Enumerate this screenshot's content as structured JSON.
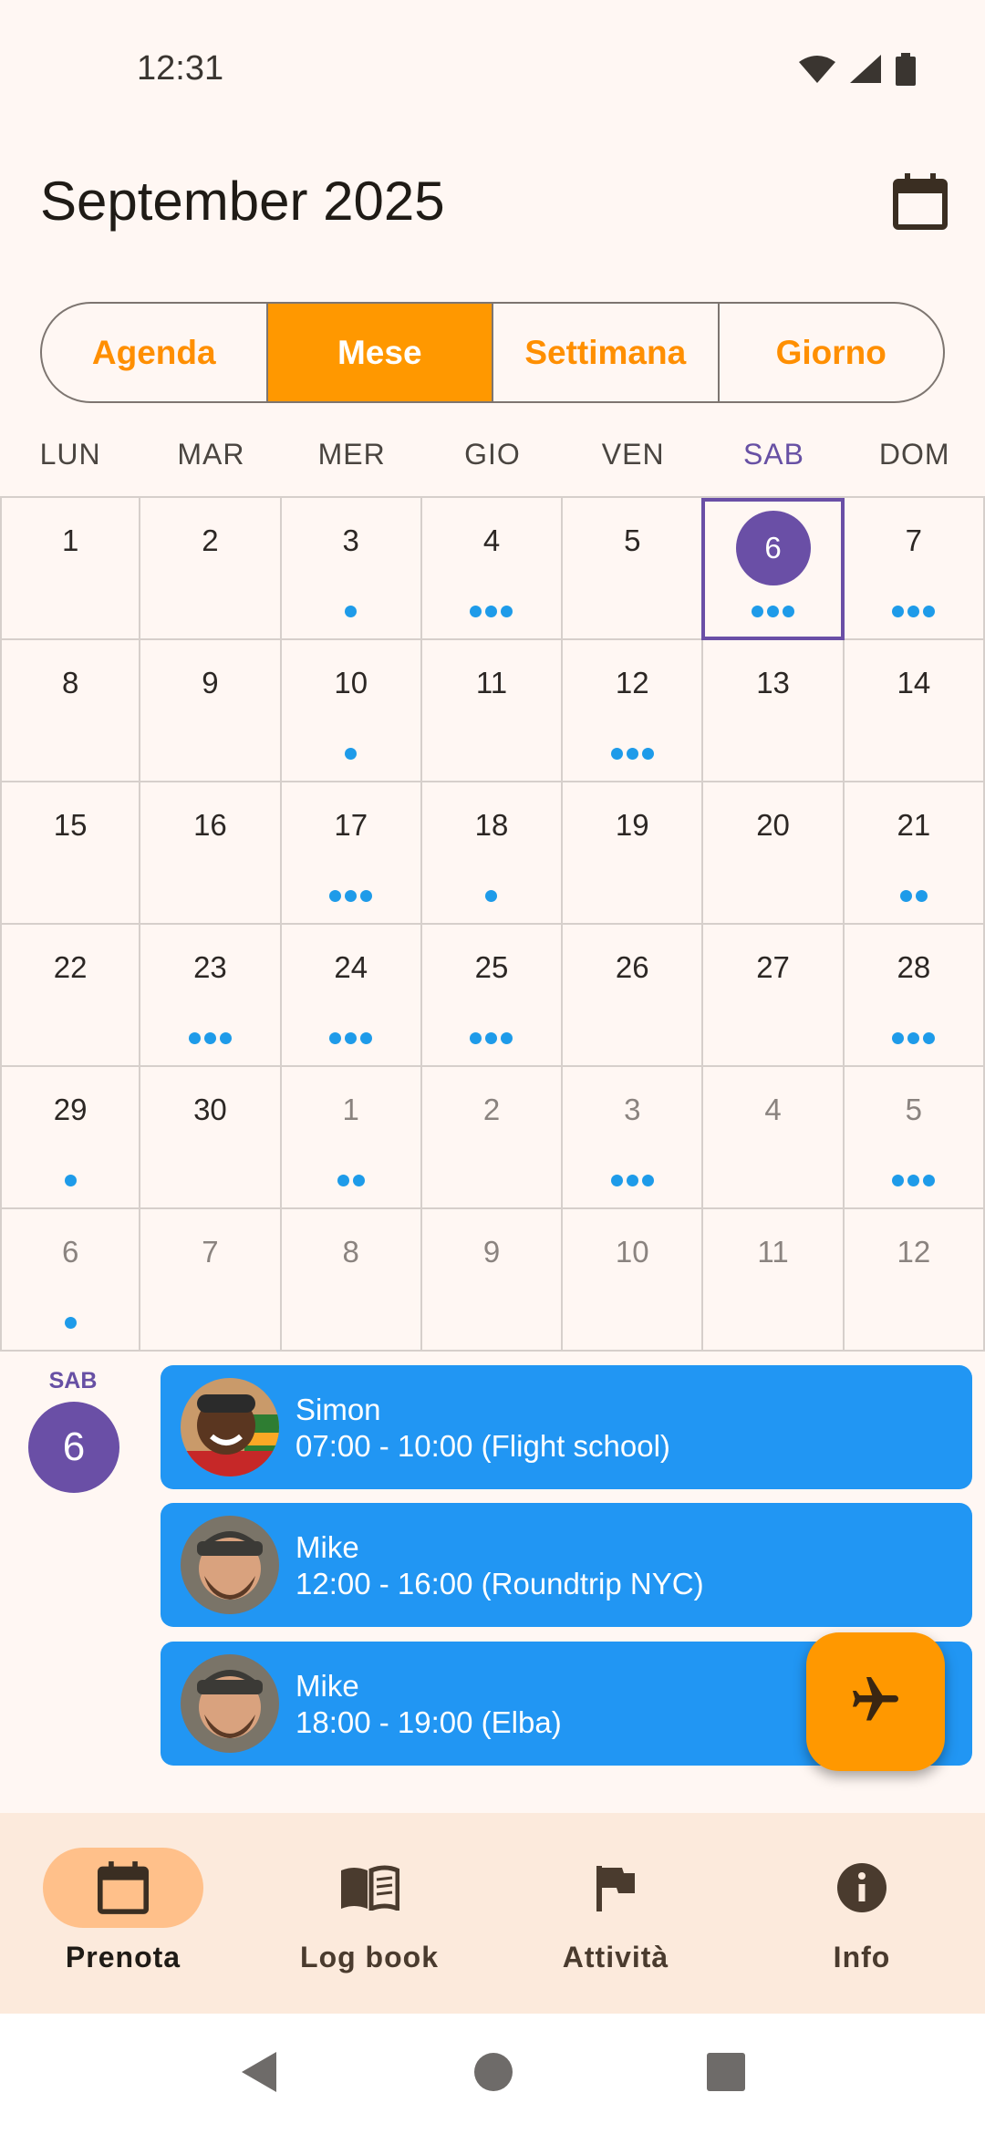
{
  "status_bar": {
    "time": "12:31",
    "icons": [
      "wifi-icon",
      "signal-icon",
      "battery-icon"
    ]
  },
  "header": {
    "title": "September 2025",
    "calendar_icon": "calendar-icon"
  },
  "view_tabs": [
    {
      "label": "Agenda",
      "active": false
    },
    {
      "label": "Mese",
      "active": true
    },
    {
      "label": "Settimana",
      "active": false
    },
    {
      "label": "Giorno",
      "active": false
    }
  ],
  "weekdays": [
    "LUN",
    "MAR",
    "MER",
    "GIO",
    "VEN",
    "SAB",
    "DOM"
  ],
  "calendar": {
    "selected_weekday_index": 5,
    "cells": [
      {
        "day": "1",
        "dots": 0,
        "other": false
      },
      {
        "day": "2",
        "dots": 0,
        "other": false
      },
      {
        "day": "3",
        "dots": 1,
        "other": false
      },
      {
        "day": "4",
        "dots": 3,
        "other": false
      },
      {
        "day": "5",
        "dots": 0,
        "other": false
      },
      {
        "day": "6",
        "dots": 3,
        "other": false,
        "selected": true
      },
      {
        "day": "7",
        "dots": 3,
        "other": false
      },
      {
        "day": "8",
        "dots": 0,
        "other": false
      },
      {
        "day": "9",
        "dots": 0,
        "other": false
      },
      {
        "day": "10",
        "dots": 1,
        "other": false
      },
      {
        "day": "11",
        "dots": 0,
        "other": false
      },
      {
        "day": "12",
        "dots": 3,
        "other": false
      },
      {
        "day": "13",
        "dots": 0,
        "other": false
      },
      {
        "day": "14",
        "dots": 0,
        "other": false
      },
      {
        "day": "15",
        "dots": 0,
        "other": false
      },
      {
        "day": "16",
        "dots": 0,
        "other": false
      },
      {
        "day": "17",
        "dots": 3,
        "other": false
      },
      {
        "day": "18",
        "dots": 1,
        "other": false
      },
      {
        "day": "19",
        "dots": 0,
        "other": false
      },
      {
        "day": "20",
        "dots": 0,
        "other": false
      },
      {
        "day": "21",
        "dots": 2,
        "other": false
      },
      {
        "day": "22",
        "dots": 0,
        "other": false
      },
      {
        "day": "23",
        "dots": 3,
        "other": false
      },
      {
        "day": "24",
        "dots": 3,
        "other": false
      },
      {
        "day": "25",
        "dots": 3,
        "other": false
      },
      {
        "day": "26",
        "dots": 0,
        "other": false
      },
      {
        "day": "27",
        "dots": 0,
        "other": false
      },
      {
        "day": "28",
        "dots": 3,
        "other": false
      },
      {
        "day": "29",
        "dots": 1,
        "other": false
      },
      {
        "day": "30",
        "dots": 0,
        "other": false
      },
      {
        "day": "1",
        "dots": 2,
        "other": true
      },
      {
        "day": "2",
        "dots": 0,
        "other": true
      },
      {
        "day": "3",
        "dots": 3,
        "other": true
      },
      {
        "day": "4",
        "dots": 0,
        "other": true
      },
      {
        "day": "5",
        "dots": 3,
        "other": true
      },
      {
        "day": "6",
        "dots": 1,
        "other": true
      },
      {
        "day": "7",
        "dots": 0,
        "other": true
      },
      {
        "day": "8",
        "dots": 0,
        "other": true
      },
      {
        "day": "9",
        "dots": 0,
        "other": true
      },
      {
        "day": "10",
        "dots": 0,
        "other": true
      },
      {
        "day": "11",
        "dots": 0,
        "other": true
      },
      {
        "day": "12",
        "dots": 0,
        "other": true
      }
    ]
  },
  "selected_day": {
    "weekday": "SAB",
    "day": "6"
  },
  "events": [
    {
      "name": "Simon",
      "time": "07:00 - 10:00 (Flight school)",
      "avatar": "avatar-simon"
    },
    {
      "name": "Mike",
      "time": "12:00 - 16:00 (Roundtrip NYC)",
      "avatar": "avatar-mike"
    },
    {
      "name": "Mike",
      "time": "18:00 - 19:00 (Elba)",
      "avatar": "avatar-mike"
    }
  ],
  "fab": {
    "icon": "airplane-icon"
  },
  "bottom_nav": [
    {
      "label": "Prenota",
      "icon": "calendar-icon",
      "active": true
    },
    {
      "label": "Log book",
      "icon": "book-icon",
      "active": false
    },
    {
      "label": "Attività",
      "icon": "flag-icon",
      "active": false
    },
    {
      "label": "Info",
      "icon": "info-icon",
      "active": false
    }
  ],
  "system_nav": [
    "back-icon",
    "home-icon",
    "recents-icon"
  ],
  "colors": {
    "primary": "#FF9800",
    "selected": "#6A4FA6",
    "event": "#2196F3",
    "dot": "#1E9BE9",
    "background": "#FFF7F3"
  }
}
